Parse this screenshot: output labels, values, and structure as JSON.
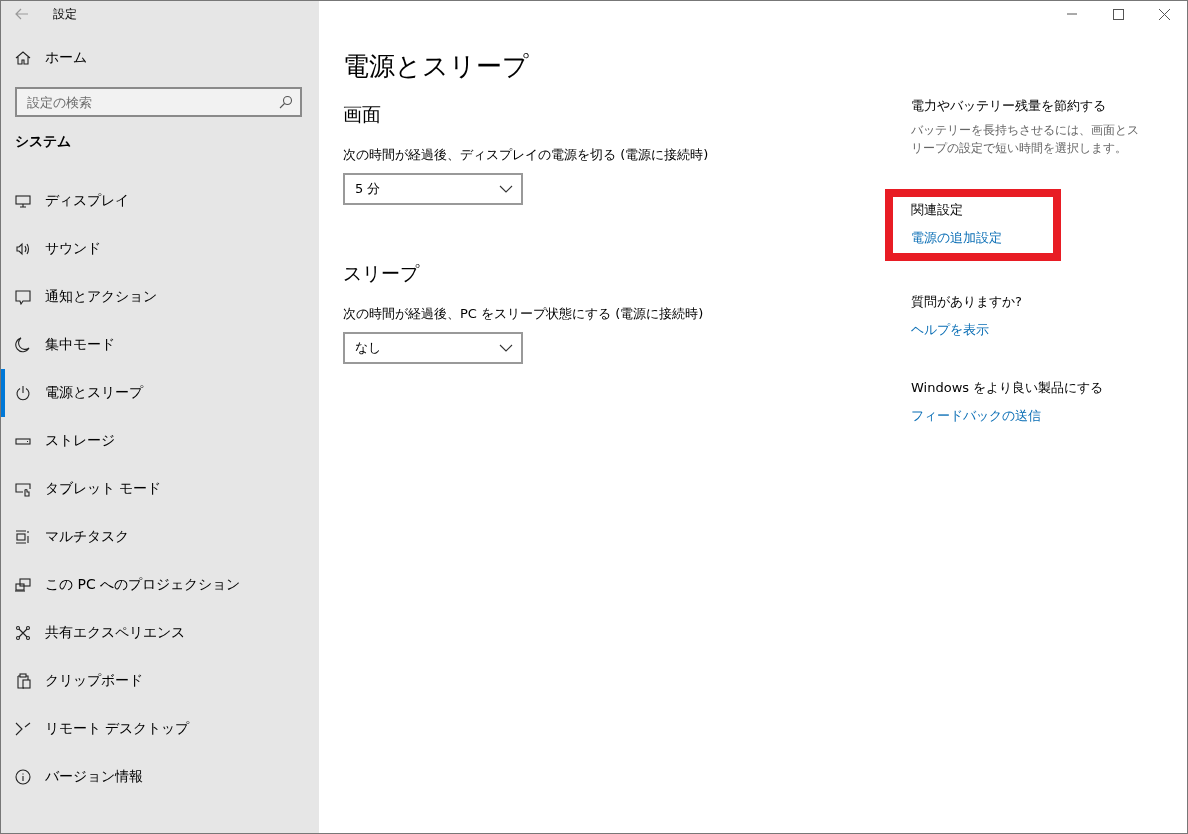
{
  "window": {
    "title": "設定"
  },
  "sidebar": {
    "home": "ホーム",
    "search": {
      "placeholder": "設定の検索"
    },
    "section": "システム",
    "items": [
      {
        "label": "ディスプレイ",
        "selected": false
      },
      {
        "label": "サウンド",
        "selected": false
      },
      {
        "label": "通知とアクション",
        "selected": false
      },
      {
        "label": "集中モード",
        "selected": false
      },
      {
        "label": "電源とスリープ",
        "selected": true
      },
      {
        "label": "ストレージ",
        "selected": false
      },
      {
        "label": "タブレット モード",
        "selected": false
      },
      {
        "label": "マルチタスク",
        "selected": false
      },
      {
        "label": "この PC へのプロジェクション",
        "selected": false
      },
      {
        "label": "共有エクスペリエンス",
        "selected": false
      },
      {
        "label": "クリップボード",
        "selected": false
      },
      {
        "label": "リモート デスクトップ",
        "selected": false
      },
      {
        "label": "バージョン情報",
        "selected": false
      }
    ]
  },
  "main": {
    "title": "電源とスリープ",
    "groups": [
      {
        "heading": "画面",
        "label": "次の時間が経過後、ディスプレイの電源を切る (電源に接続時)",
        "value": "5 分"
      },
      {
        "heading": "スリープ",
        "label": "次の時間が経過後、PC をスリープ状態にする (電源に接続時)",
        "value": "なし"
      }
    ]
  },
  "aside": [
    {
      "heading": "電力やバッテリー残量を節約する",
      "text": "バッテリーを長持ちさせるには、画面とスリープの設定で短い時間を選択します。",
      "highlighted": false
    },
    {
      "heading": "関連設定",
      "link": "電源の追加設定",
      "highlighted": true
    },
    {
      "heading": "質問がありますか?",
      "link": "ヘルプを表示",
      "highlighted": false
    },
    {
      "heading": "Windows をより良い製品にする",
      "link": "フィードバックの送信",
      "highlighted": false
    }
  ]
}
